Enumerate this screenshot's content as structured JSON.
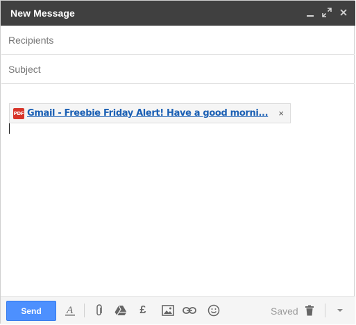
{
  "window": {
    "title": "New Message",
    "controls": [
      "minimize-icon",
      "expand-icon",
      "close-icon"
    ]
  },
  "fields": {
    "recipients_placeholder": "Recipients",
    "subject_placeholder": "Subject"
  },
  "attachment": {
    "badge": "PDF",
    "name": "Gmail - Freebie Friday Alert! Have a good morni...",
    "remove": "×"
  },
  "toolbar": {
    "send_label": "Send",
    "status": "Saved",
    "icons": [
      "formatting-icon",
      "attach-icon",
      "drive-icon",
      "money-icon",
      "photo-icon",
      "link-icon",
      "emoji-icon",
      "trash-icon",
      "more-options-icon"
    ]
  },
  "colors": {
    "titlebar": "#404040",
    "send": "#4d90fe",
    "link": "#1a5fb4",
    "pdf": "#d8352a"
  }
}
